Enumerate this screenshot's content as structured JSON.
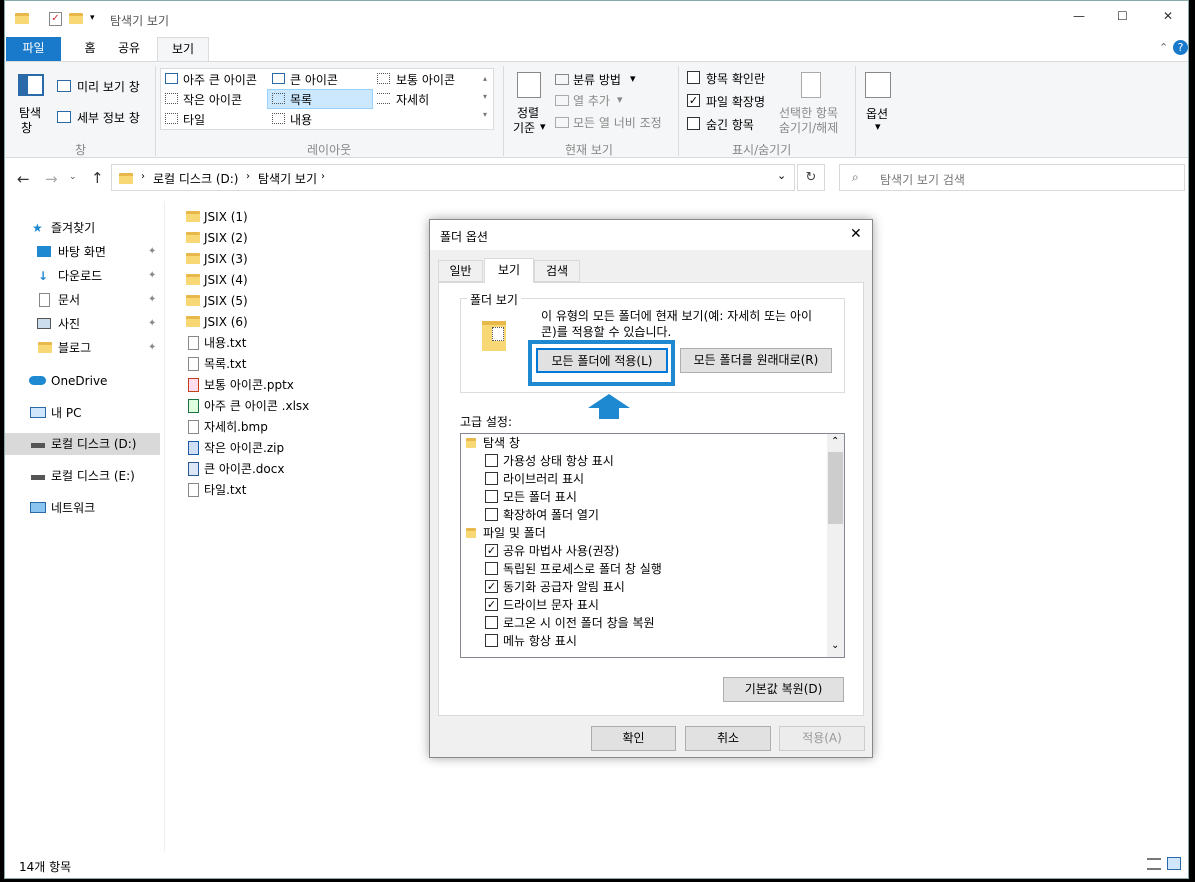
{
  "window": {
    "title": "탐색기 보기"
  },
  "titlebar": {
    "minimize": "—",
    "maximize": "☐",
    "close": "✕"
  },
  "ribbon": {
    "tabs": [
      "파일",
      "홈",
      "공유",
      "보기"
    ],
    "pane_group": {
      "nav_pane_label1": "탐색",
      "nav_pane_label2": "창",
      "preview_pane": "미리 보기 창",
      "details_pane": "세부 정보 창",
      "group_label": "창"
    },
    "layout": {
      "xl_icons": "아주 큰 아이콘",
      "large_icons": "큰 아이콘",
      "medium_icons": "보통 아이콘",
      "small_icons": "작은 아이콘",
      "list": "목록",
      "details": "자세히",
      "tiles": "타일",
      "content": "내용",
      "group_label": "레이아웃"
    },
    "current_view": {
      "sort_label1": "정렬",
      "sort_label2": "기준",
      "group_by": "분류 방법",
      "add_column": "열 추가",
      "size_columns": "모든 열 너비 조정",
      "group_label": "현재 보기"
    },
    "showhide": {
      "item_checkboxes": "항목 확인란",
      "file_extensions": "파일 확장명",
      "hidden_items": "숨긴 항목",
      "hide_selected1": "선택한 항목",
      "hide_selected2": "숨기기/해제",
      "group_label": "표시/숨기기"
    },
    "options": {
      "label": "옵션"
    }
  },
  "address": {
    "path": [
      "로컬 디스크 (D:)",
      "탐색기 보기"
    ],
    "search_placeholder": "탐색기 보기 검색"
  },
  "nav": {
    "quick_access": "즐겨찾기",
    "desktop": "바탕 화면",
    "downloads": "다운로드",
    "documents": "문서",
    "pictures": "사진",
    "blog": "블로그",
    "onedrive": "OneDrive",
    "this_pc": "내 PC",
    "local_d": "로컬 디스크 (D:)",
    "local_e": "로컬 디스크 (E:)",
    "network": "네트워크"
  },
  "files": [
    "JSIX (1)",
    "JSIX (2)",
    "JSIX (3)",
    "JSIX (4)",
    "JSIX (5)",
    "JSIX (6)",
    "내용.txt",
    "목록.txt",
    "보통 아이콘.pptx",
    "아주 큰 아이콘 .xlsx",
    "자세히.bmp",
    "작은 아이콘.zip",
    "큰 아이콘.docx",
    "타일.txt"
  ],
  "status": {
    "count": "14개 항목"
  },
  "dialog": {
    "title": "폴더 옵션",
    "tabs": [
      "일반",
      "보기",
      "검색"
    ],
    "folder_views_label": "폴더 보기",
    "folder_views_desc1": "이 유형의 모든 폴더에 현재 보기(예: 자세히 또는 아이",
    "folder_views_desc2": "콘)를 적용할 수 있습니다.",
    "apply_to_folders": "모든 폴더에 적용(L)",
    "reset_folders": "모든 폴더를 원래대로(R)",
    "advanced_label": "고급 설정:",
    "advanced": [
      {
        "type": "folder",
        "label": "탐색 창"
      },
      {
        "type": "check",
        "checked": false,
        "label": "가용성 상태 항상 표시"
      },
      {
        "type": "check",
        "checked": false,
        "label": "라이브러리 표시"
      },
      {
        "type": "check",
        "checked": false,
        "label": "모든 폴더 표시"
      },
      {
        "type": "check",
        "checked": false,
        "label": "확장하여 폴더 열기"
      },
      {
        "type": "folder",
        "label": "파일 및 폴더"
      },
      {
        "type": "check",
        "checked": true,
        "label": "공유 마법사 사용(권장)"
      },
      {
        "type": "check",
        "checked": false,
        "label": "독립된 프로세스로 폴더 창 실행"
      },
      {
        "type": "check",
        "checked": true,
        "label": "동기화 공급자 알림 표시"
      },
      {
        "type": "check",
        "checked": true,
        "label": "드라이브 문자 표시"
      },
      {
        "type": "check",
        "checked": false,
        "label": "로그온 시 이전 폴더 창을 복원"
      },
      {
        "type": "check",
        "checked": false,
        "label": "메뉴 항상 표시"
      }
    ],
    "restore_defaults": "기본값 복원(D)",
    "ok": "확인",
    "cancel": "취소",
    "apply": "적용(A)"
  },
  "colors": {
    "accent": "#1e88d0",
    "highlight": "#cce8ff",
    "arrow": "#1e88d0"
  }
}
